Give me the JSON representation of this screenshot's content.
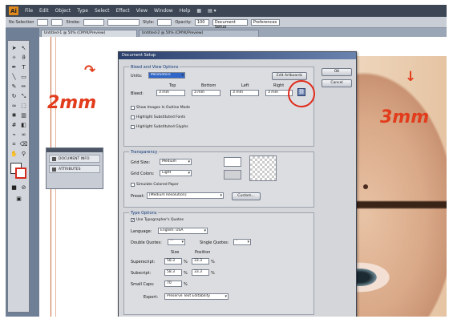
{
  "menubar": {
    "logo": "Ai",
    "items": [
      "File",
      "Edit",
      "Object",
      "Type",
      "Select",
      "Effect",
      "View",
      "Window",
      "Help"
    ]
  },
  "control_bar": {
    "selection_label": "No Selection",
    "stroke_label": "Stroke:",
    "style_label": "Style:",
    "opacity_label": "Opacity:",
    "opacity_value": "100",
    "document_setup": "Document Setup",
    "preferences": "Preferences"
  },
  "tabs": [
    "Untitled-1 @ 50% (CMYK/Preview)",
    "Untitled-2 @ 50% (CMYK/Preview)"
  ],
  "annotations": {
    "left_arrow": "↷",
    "left_label": "2mm",
    "right_arrow": "↓",
    "right_label": "3mm"
  },
  "panel": {
    "item1": "DOCUMENT INFO",
    "item2": "ATTRIBUTES"
  },
  "dialog": {
    "title": "Document Setup",
    "ok": "OK",
    "cancel": "Cancel",
    "bleed_group": "Bleed and View Options",
    "units_label": "Units:",
    "units_value": "Millimeters",
    "edit_artboards": "Edit Artboards",
    "top_label": "Top",
    "bottom_label": "Bottom",
    "left_label": "Left",
    "right_label": "Right",
    "bleed_label": "Bleed:",
    "bleed_top": "3 mm",
    "bleed_bottom": "3 mm",
    "bleed_left": "3 mm",
    "bleed_right": "3 mm",
    "show_images": "Show Images In Outline Mode",
    "highlight_fonts": "Highlight Substituted Fonts",
    "highlight_glyphs": "Highlight Substituted Glyphs",
    "transparency_group": "Transparency",
    "grid_size_label": "Grid Size:",
    "grid_size_value": "Medium",
    "grid_colors_label": "Grid Colors:",
    "grid_colors_value": "Light",
    "simulate_paper": "Simulate Colored Paper",
    "preset_label": "Preset:",
    "preset_value": "[Medium Resolution]",
    "custom_button": "Custom...",
    "type_group": "Type Options",
    "typographers_quotes": "Use Typographer's Quotes",
    "language_label": "Language:",
    "language_value": "English: USA",
    "double_quotes_label": "Double Quotes:",
    "double_quotes_value": "“”",
    "single_quotes_label": "Single Quotes:",
    "single_quotes_value": "‘’",
    "size_header": "Size",
    "position_header": "Position",
    "superscript_label": "Superscript:",
    "superscript_size": "58.3",
    "superscript_pos": "33.3",
    "subscript_label": "Subscript:",
    "subscript_size": "58.3",
    "subscript_pos": "33.3",
    "small_caps_label": "Small Caps:",
    "small_caps_value": "70",
    "percent": "%",
    "export_label": "Export:",
    "export_value": "Preserve Text Editability"
  }
}
